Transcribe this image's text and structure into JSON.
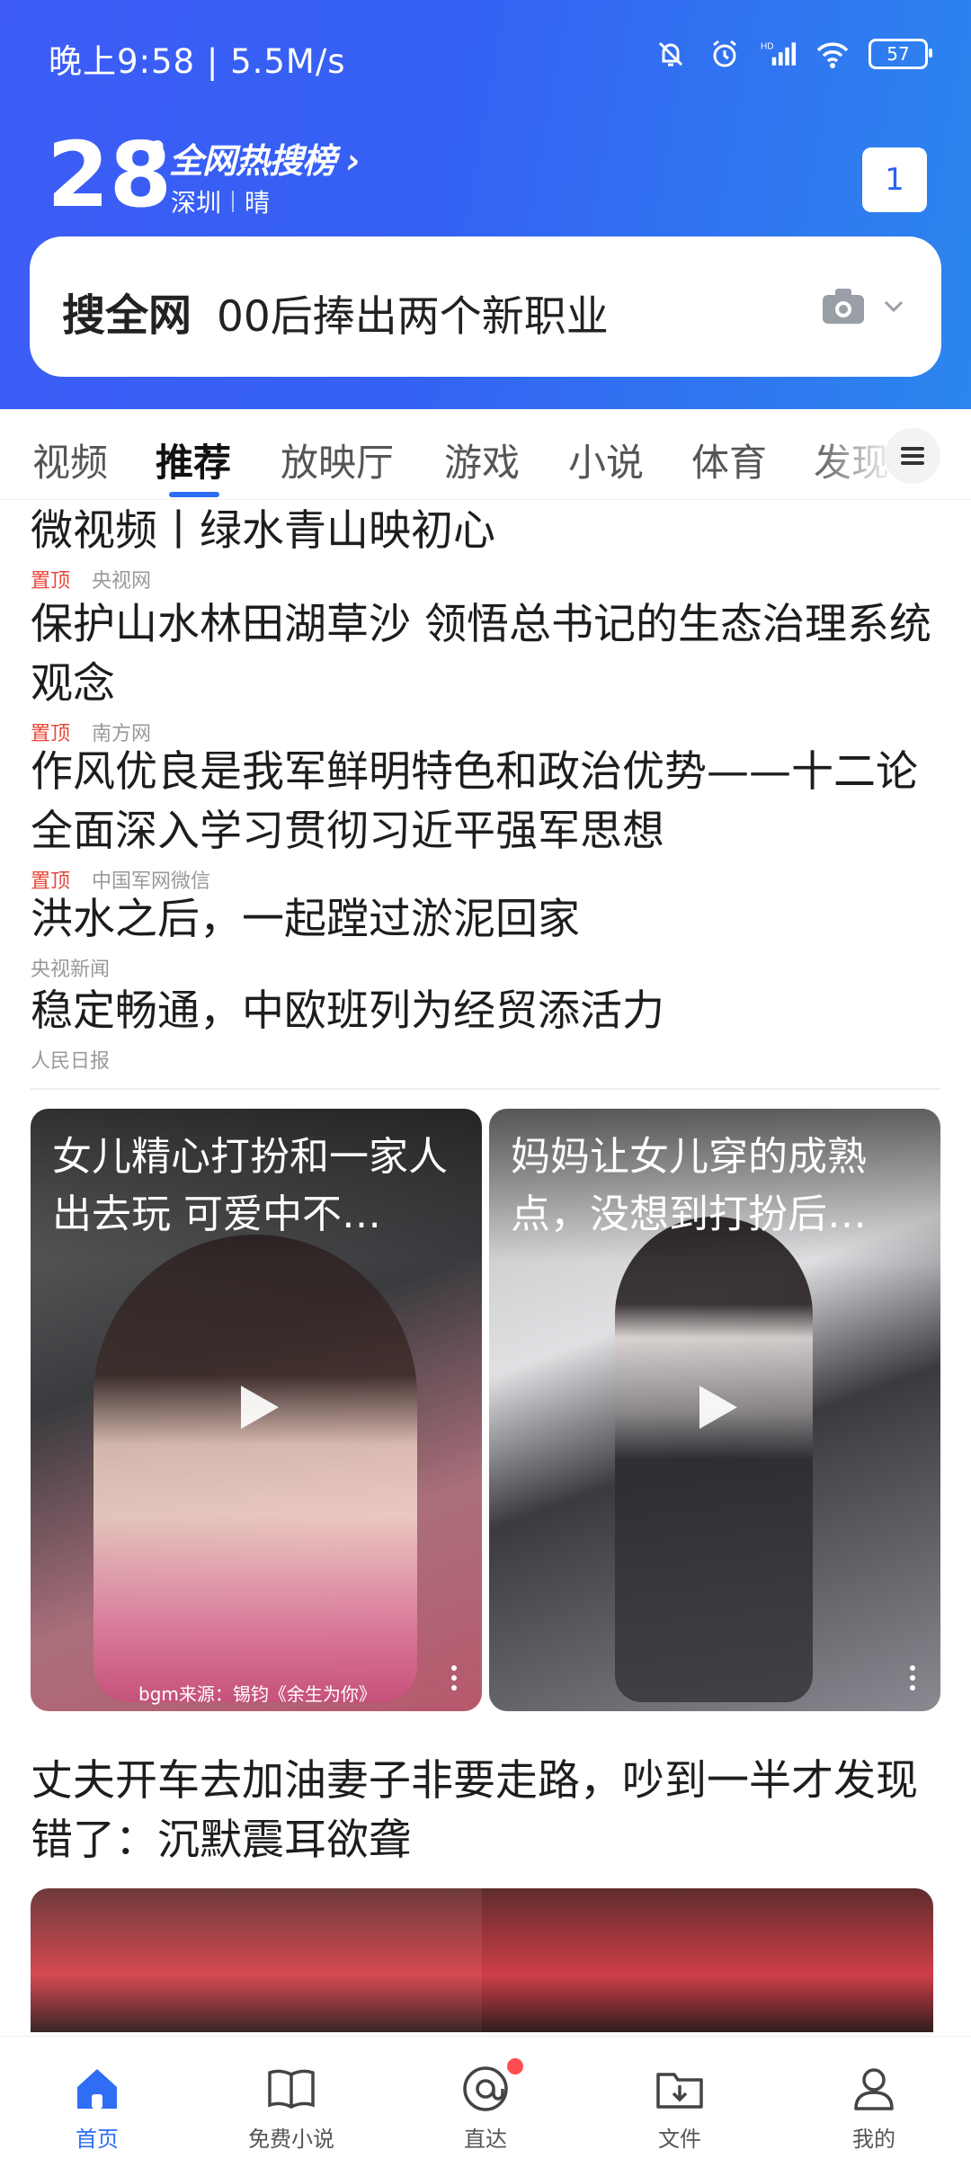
{
  "status_bar": {
    "time_speed": "晚上9:58 | 5.5M/s",
    "battery": "57"
  },
  "header": {
    "temperature": "28",
    "degree": "°",
    "hot_list_title": "全网热搜榜",
    "hot_list_arrow": "›",
    "city": "深圳",
    "weather": "晴",
    "badge_count": "1"
  },
  "search": {
    "label": "搜全网",
    "query": "00后捧出两个新职业"
  },
  "tabs": [
    "视频",
    "推荐",
    "放映厅",
    "游戏",
    "小说",
    "体育",
    "发现"
  ],
  "active_tab": "推荐",
  "news": [
    {
      "title": "微视频丨绿水青山映初心",
      "pin": "置顶",
      "source": "央视网"
    },
    {
      "title": "保护山水林田湖草沙 领悟总书记的生态治理系统观念",
      "pin": "置顶",
      "source": "南方网"
    },
    {
      "title": "作风优良是我军鲜明特色和政治优势——十二论全面深入学习贯彻习近平强军思想",
      "pin": "置顶",
      "source": "中国军网微信"
    },
    {
      "title": "洪水之后，一起蹚过淤泥回家",
      "pin": "",
      "source": "央视新闻"
    },
    {
      "title": "稳定畅通，中欧班列为经贸添活力",
      "pin": "",
      "source": "人民日报"
    }
  ],
  "videos": [
    {
      "title": "女儿精心打扮和一家人出去玩 可爱中不…",
      "caption": "bgm来源：锡钧《余生为你》"
    },
    {
      "title": "妈妈让女儿穿的成熟点，没想到打扮后…",
      "caption": ""
    }
  ],
  "article": {
    "title": "丈夫开车去加油妻子非要走路，吵到一半才发现错了：沉默震耳欲聋"
  },
  "bottom_nav": [
    {
      "label": "首页",
      "icon": "home-icon"
    },
    {
      "label": "免费小说",
      "icon": "book-icon"
    },
    {
      "label": "直达",
      "icon": "at-icon"
    },
    {
      "label": "文件",
      "icon": "folder-icon"
    },
    {
      "label": "我的",
      "icon": "user-icon"
    }
  ],
  "colors": {
    "accent": "#2f6df5",
    "pin_red": "#e8473b",
    "header_start": "#3d5cf6",
    "header_end": "#2c86ee"
  }
}
